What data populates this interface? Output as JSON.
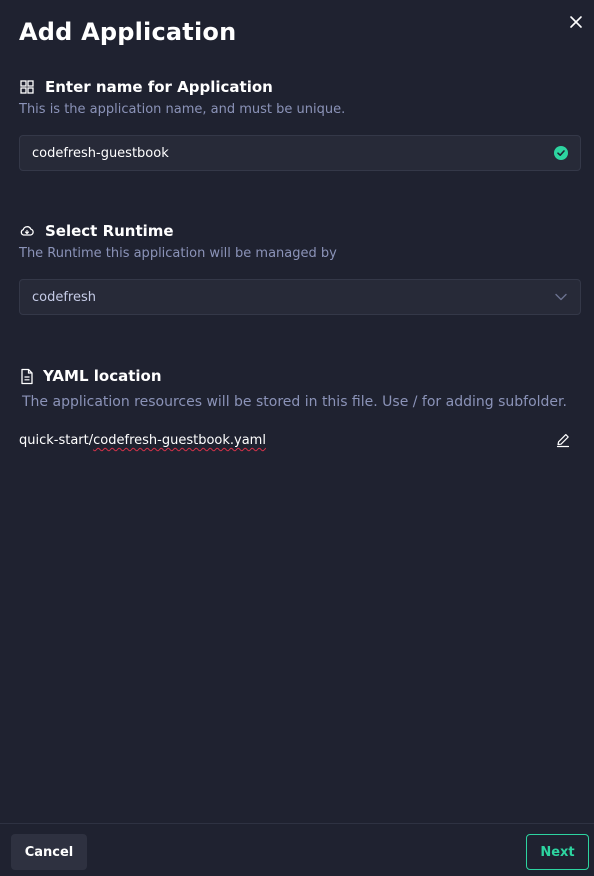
{
  "modal": {
    "title": "Add Application"
  },
  "name_section": {
    "title": "Enter name for Application",
    "subtitle": "This is the application name, and must be unique.",
    "icon": "grid-icon",
    "value": "codefresh-guestbook",
    "status_icon": "check-circle-icon"
  },
  "runtime_section": {
    "title": "Select Runtime",
    "subtitle": "The Runtime this application will be managed by",
    "icon": "cloud-icon",
    "selected": "codefresh"
  },
  "yaml_section": {
    "title": "YAML location",
    "subtitle": "The application resources will be stored in this file. Use / for adding subfolder.",
    "icon": "file-icon",
    "path_prefix": "quick-start/",
    "path_file": "codefresh-guestbook.yaml"
  },
  "footer": {
    "cancel_label": "Cancel",
    "next_label": "Next"
  },
  "colors": {
    "background": "#1f2230",
    "field_bg": "#272a38",
    "accent": "#2dd4a0",
    "muted_text": "#8b93b8"
  }
}
